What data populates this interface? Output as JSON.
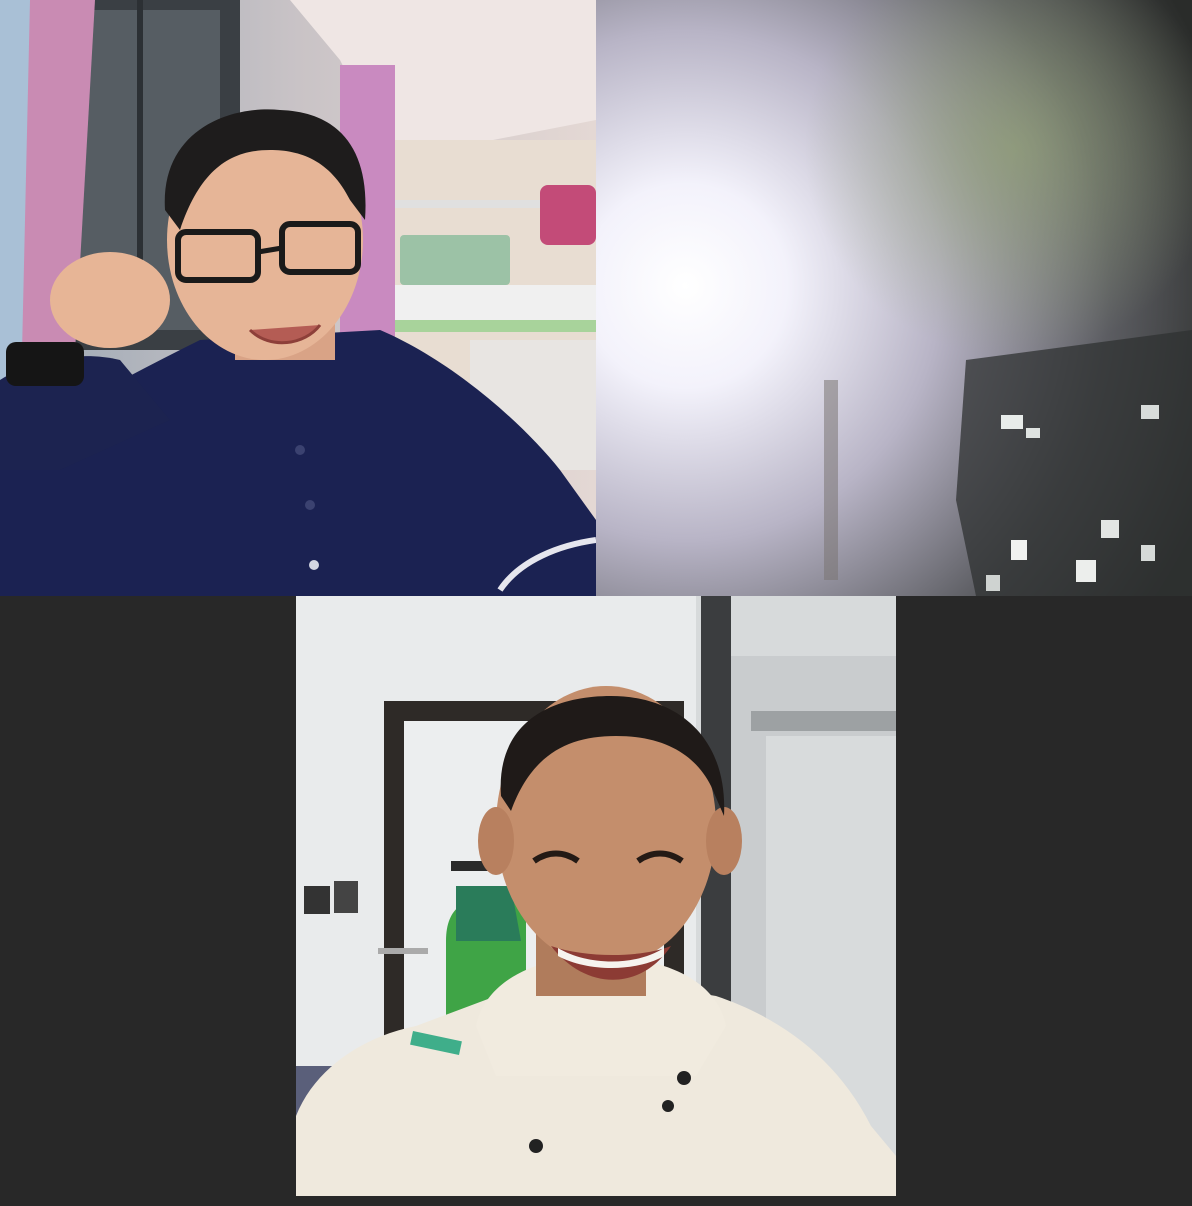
{
  "call": {
    "participants": [
      {
        "id": "participant-1",
        "video": "camera-on",
        "scene": "man-with-glasses-bunk-bed-room"
      },
      {
        "id": "participant-2",
        "video": "camera-on",
        "scene": "bright-light-glare-night-window"
      },
      {
        "id": "participant-3",
        "video": "camera-on",
        "scene": "smiling-man-white-hoodie-room"
      }
    ]
  },
  "colors": {
    "background": "#282828"
  }
}
